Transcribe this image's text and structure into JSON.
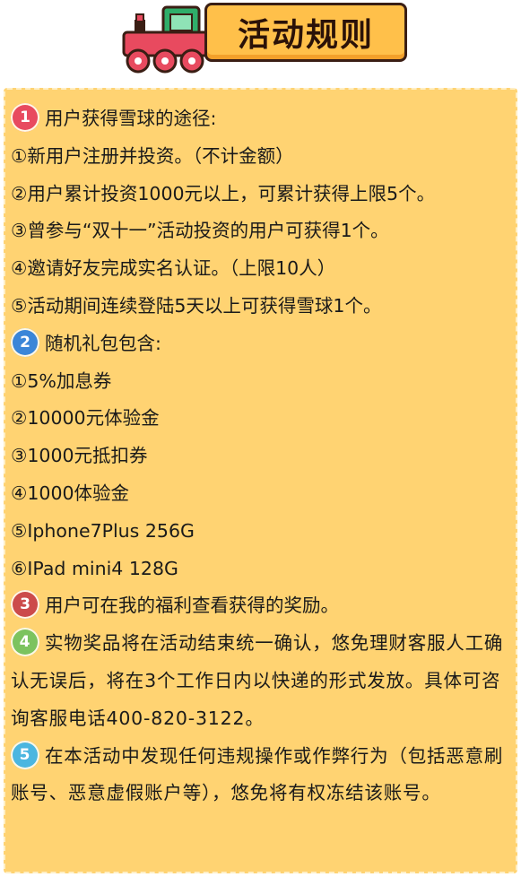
{
  "header": {
    "title": "活动规则",
    "icon": "toy-train-icon",
    "colors": {
      "title_bg": "#ffc04a",
      "card_bg": "#ffd372"
    }
  },
  "sections": [
    {
      "badge": "1",
      "title": "用户获得雪球的途径:",
      "items": [
        "①新用户注册并投资。（不计金额）",
        "②用户累计投资1000元以上，可累计获得上限5个。",
        "③曾参与“双十一”活动投资的用户可获得1个。",
        "④邀请好友完成实名认证。（上限10人）",
        "⑤活动期间连续登陆5天以上可获得雪球1个。"
      ]
    },
    {
      "badge": "2",
      "title": "随机礼包包含:",
      "items": [
        "①5%加息券",
        "②10000元体验金",
        "③1000元抵扣券",
        "④1000体验金",
        "⑤Iphone7Plus 256G",
        "⑥IPad mini4 128G"
      ]
    },
    {
      "badge": "3",
      "title": "用户可在我的福利查看获得的奖励。"
    },
    {
      "badge": "4",
      "title": "实物奖品将在活动结束统一确认，悠免理财客服人工确认无误后，将在3个工作日内以快递的形式发放。具体可咨询客服电话400-820-3122。"
    },
    {
      "badge": "5",
      "title": "在本活动中发现任何违规操作或作弊行为（包括恶意刷账号、恶意虚假账户等），悠免将有权冻结该账号。"
    }
  ]
}
